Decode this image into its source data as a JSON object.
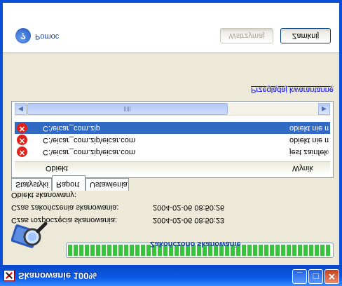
{
  "window": {
    "title": "Skanowanie 100%"
  },
  "titlebar_buttons": {
    "minimize": "_",
    "maximize": "□",
    "close": "✕"
  },
  "progress": {
    "value": 1.0,
    "label": "Zakończono skanowanie",
    "color": "#37c43a"
  },
  "info": {
    "start_label": "Czas rozpoczęcia skanowania:",
    "start_value": "2004-02-06 08:50:23",
    "end_label": "Czas zakończenia skanowania:",
    "end_value": "2004-02-06 08:50:26",
    "object_label": "Obiekt skanowany:"
  },
  "tabs": [
    {
      "label": "Statystyki",
      "active": false
    },
    {
      "label": "Raport",
      "active": true
    },
    {
      "label": "Ustawienia",
      "active": false
    }
  ],
  "list": {
    "columns": [
      "Obiekt",
      "Wynik"
    ],
    "rows": [
      {
        "object": "C:\\eicar_com.zip\\eicar.com",
        "result": "jest zainfekowany",
        "selected": false
      },
      {
        "object": "C:\\eicar_com.zip\\eicar.com",
        "result": "obiekt nie może",
        "selected": false
      },
      {
        "object": "C:\\eicar_com.zip",
        "result": "obiekt nie może",
        "selected": true
      }
    ]
  },
  "quarantine_link": "Przeglądaj kwarantannę",
  "footer": {
    "help_label": "Pomoc",
    "stop_button": "Wstrzymaj",
    "close_button": "Zamknij"
  },
  "icons": {
    "app": "kaspersky-icon",
    "help": "help-icon",
    "error": "error-icon",
    "scan": "scan-magnifier-icon"
  },
  "colors": {
    "accent": "#0a5ae6",
    "link": "#0000ff",
    "selection": "#316ac5",
    "error": "#e2231a"
  }
}
